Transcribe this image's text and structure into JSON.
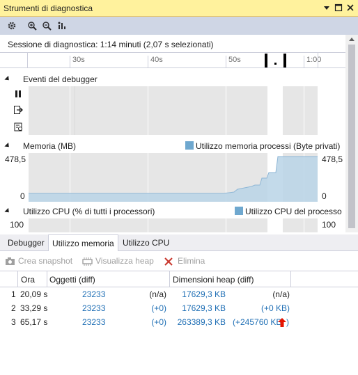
{
  "window": {
    "title": "Strumenti di diagnostica"
  },
  "toolbar_icons": [
    "gear-icon",
    "zoom-in-icon",
    "zoom-out-icon",
    "reset-zoom-icon"
  ],
  "session": {
    "text": "Sessione di diagnostica: 1:14 minuti (2,07 s selezionati)"
  },
  "ruler": {
    "ticks": [
      "30s",
      "40s",
      "50s",
      "1:00"
    ]
  },
  "sections": {
    "debugger_events": {
      "label": "Eventi del debugger"
    },
    "memory": {
      "label": "Memoria (MB)",
      "legend": "Utilizzo memoria processi (Byte privati)",
      "max": "478,5",
      "min": "0",
      "max_right": "478,5",
      "min_right": "0"
    },
    "cpu": {
      "label": "Utilizzo CPU (% di tutti i processori)",
      "legend": "Utilizzo CPU del processo",
      "max": "100",
      "max_right": "100"
    }
  },
  "tabs": [
    {
      "label": "Debugger",
      "active": false
    },
    {
      "label": "Utilizzo memoria",
      "active": true
    },
    {
      "label": "Utilizzo CPU",
      "active": false
    }
  ],
  "actions": {
    "snapshot": "Crea snapshot",
    "heap": "Visualizza heap",
    "delete": "Elimina"
  },
  "grid": {
    "columns": [
      "Ora",
      "Oggetti (diff)",
      "Dimensioni heap (diff)"
    ],
    "rows": [
      {
        "index": "1",
        "time": "20,09 s",
        "objects": "23233",
        "objects_diff": "(n/a)",
        "heap": "17629,3 KB",
        "heap_diff": "(n/a)"
      },
      {
        "index": "2",
        "time": "33,29 s",
        "objects": "23233",
        "objects_diff": "(+0)",
        "heap": "17629,3 KB",
        "heap_diff": "(+0 KB)"
      },
      {
        "index": "3",
        "time": "65,17 s",
        "objects": "23233",
        "objects_diff": "(+0)",
        "heap": "263389,3 KB",
        "heap_diff": "(+245760 KB",
        "heap_diff_close": ")"
      }
    ]
  },
  "colors": {
    "title_bg": "#fff29d",
    "legend_memory": "#6fa8cf",
    "link": "#1f6fb5",
    "increase": "#e51400"
  }
}
